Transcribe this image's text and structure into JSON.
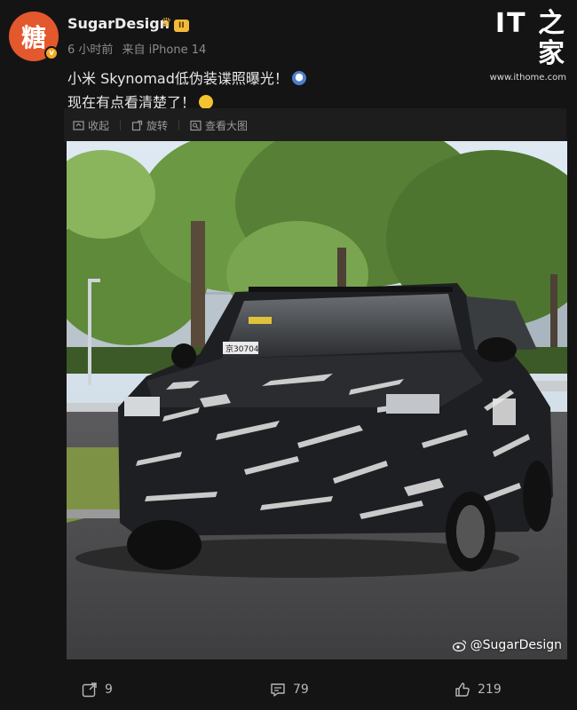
{
  "author": {
    "avatar_glyph": "糖",
    "name": "SugarDesign",
    "level_badge": "II",
    "time": "6 小时前",
    "source": "来自 iPhone 14"
  },
  "watermark_top": {
    "logo": "IT 之家",
    "url": "www.ithome.com"
  },
  "post": {
    "line1": "小米 Skynomad低伪装谍照曝光！",
    "line2": "现在有点看清楚了！"
  },
  "toolbar": {
    "collapse": "收起",
    "rotate": "旋转",
    "view_large": "查看大图"
  },
  "photo": {
    "watermark": "@SugarDesign",
    "plate": "京30704"
  },
  "actions": {
    "repost_count": "9",
    "comment_count": "79",
    "like_count": "219"
  },
  "colors": {
    "background": "#141414",
    "avatar": "#e4582d",
    "badge": "#f3b93a"
  }
}
